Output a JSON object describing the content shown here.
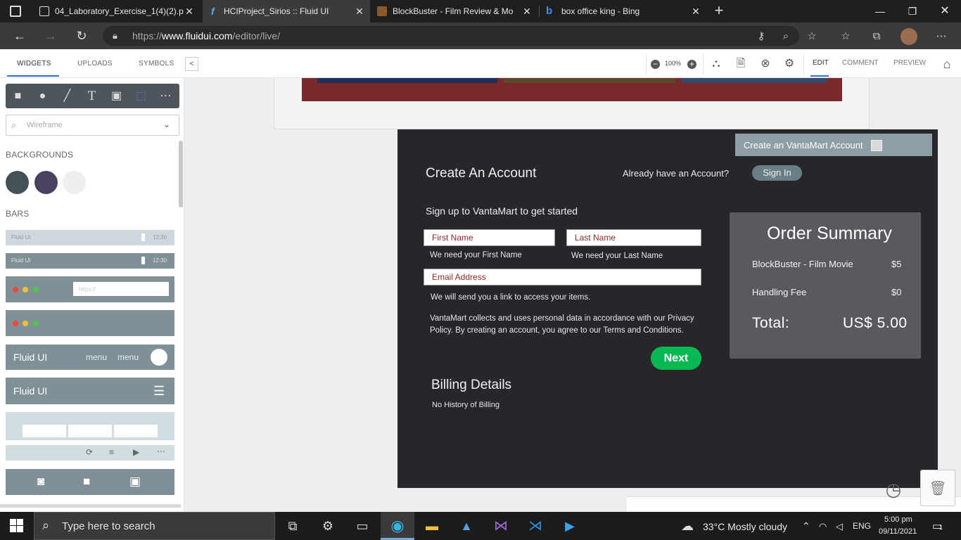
{
  "browser": {
    "tabs": [
      {
        "title": "04_Laboratory_Exercise_1(4)(2).p",
        "icon": "document-icon"
      },
      {
        "title": "HCIProject_Sirios :: Fluid UI",
        "icon": "fluid-ui-icon"
      },
      {
        "title": "BlockBuster - Film Review & Mo",
        "icon": "blockbuster-icon"
      },
      {
        "title": "box office king - Bing",
        "icon": "bing-icon"
      }
    ],
    "url_prefix": "https://",
    "url_domain": "www.fluidui.com",
    "url_path": "/editor/live/"
  },
  "toolbar": {
    "left_tabs": [
      "WIDGETS",
      "UPLOADS",
      "SYMBOLS"
    ],
    "zoom": "100%",
    "right_tabs": [
      "EDIT",
      "COMMENT",
      "PREVIEW"
    ]
  },
  "left_panel": {
    "search_placeholder": "Wireframe",
    "backgrounds_title": "BACKGROUNDS",
    "bars_title": "BARS",
    "swatch_colors": [
      "#435257",
      "#4a4060",
      "#efefef"
    ],
    "bar1": {
      "label": "Fluid UI",
      "time": "12:30"
    },
    "bar2": {
      "label": "Fluid UI",
      "time": "12:30"
    },
    "url_placeholder": "https://",
    "bar5": {
      "title": "Fluid UI",
      "menu1": "menu",
      "menu2": "menu"
    },
    "bar6": {
      "title": "Fluid UI"
    }
  },
  "account_form": {
    "panel_tab": "Create an VantaMart Account",
    "heading": "Create An Account",
    "already_text": "Already have an Account?",
    "sign_in": "Sign In",
    "subtitle": "Sign up to VantaMart to get started",
    "first_name_placeholder": "First Name",
    "last_name_placeholder": "Last Name",
    "first_name_help": "We need your First Name",
    "last_name_help": "We need your Last Name",
    "email_placeholder": "Email Address",
    "email_help": "We will send you a link to access your items.",
    "privacy_line1": "VantaMart collects and uses personal data in accordance with our Privacy",
    "privacy_line2": "Policy. By creating an account, you agree to our Terms and Conditions.",
    "next_button": "Next",
    "billing_title": "Billing Details",
    "billing_text": "No History of Billing"
  },
  "order_summary": {
    "title": "Order Summary",
    "items": [
      {
        "name": "BlockBuster - Film Movie",
        "price": "$5"
      },
      {
        "name": "Handling Fee",
        "price": "$0"
      }
    ],
    "total_label": "Total:",
    "total_value": "US$ 5.00"
  },
  "taskbar": {
    "search_placeholder": "Type here to search",
    "weather": "33°C  Mostly cloudy",
    "language": "ENG",
    "time": "5:00 pm",
    "date": "09/11/2021",
    "notification_count": "1"
  },
  "colors": {
    "card_bg": "#28262b",
    "next_green": "#08b951",
    "summary_bg": "#595a5d",
    "accent_blue": "#2a73d9"
  }
}
